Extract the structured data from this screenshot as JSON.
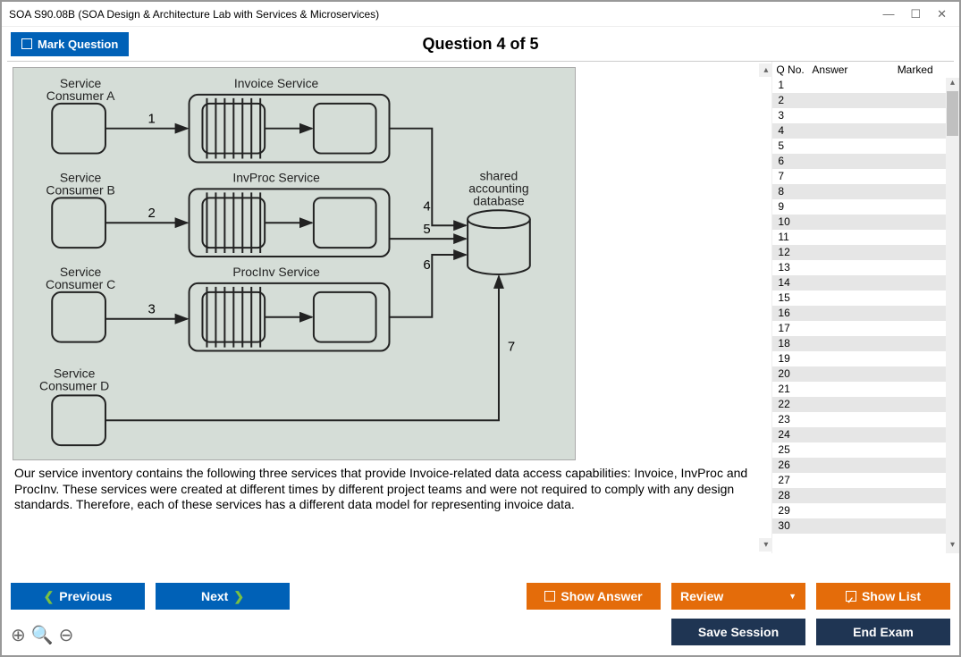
{
  "window": {
    "title": "SOA S90.08B (SOA Design & Architecture Lab with Services & Microservices)"
  },
  "header": {
    "mark_label": "Mark Question",
    "question_title": "Question 4 of 5"
  },
  "diagram": {
    "consumer_a": "Service\nConsumer A",
    "consumer_b": "Service\nConsumer B",
    "consumer_c": "Service\nConsumer C",
    "consumer_d": "Service\nConsumer D",
    "invoice_service": "Invoice Service",
    "invproc_service": "InvProc Service",
    "procinv_service": "ProcInv Service",
    "shared_db": "shared\naccounting\ndatabase",
    "n1": "1",
    "n2": "2",
    "n3": "3",
    "n4": "4",
    "n5": "5",
    "n6": "6",
    "n7": "7"
  },
  "question_text": "Our service inventory contains the following three services that provide Invoice-related data access capabilities: Invoice, InvProc and ProcInv. These services were created at different times by different project teams and were not required to comply with any design standards. Therefore, each of these services has a different data model for representing invoice data.",
  "sidebar": {
    "h1": "Q No.",
    "h2": "Answer",
    "h3": "Marked",
    "rows": [
      "1",
      "2",
      "3",
      "4",
      "5",
      "6",
      "7",
      "8",
      "9",
      "10",
      "11",
      "12",
      "13",
      "14",
      "15",
      "16",
      "17",
      "18",
      "19",
      "20",
      "21",
      "22",
      "23",
      "24",
      "25",
      "26",
      "27",
      "28",
      "29",
      "30"
    ]
  },
  "buttons": {
    "previous": "Previous",
    "next": "Next",
    "show_answer": "Show Answer",
    "review": "Review",
    "show_list": "Show List",
    "save_session": "Save Session",
    "end_exam": "End Exam"
  }
}
